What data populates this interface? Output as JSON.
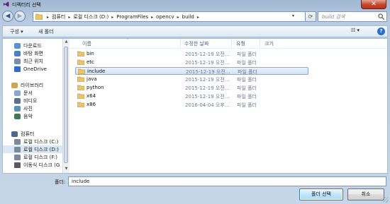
{
  "window": {
    "title": "디렉터리 선택",
    "close_label": "✕"
  },
  "address": {
    "crumbs": [
      "컴퓨터",
      "로컬 디스크 (D:)",
      "ProgramFiles",
      "opencv",
      "build"
    ],
    "separator": "▸",
    "search_placeholder": "build 검색"
  },
  "toolbar": {
    "organize_label": "구성 ▾",
    "new_folder_label": "새 폴더",
    "view_label": "☷ ▾",
    "help_label": "?"
  },
  "sidebar": {
    "items": [
      {
        "label": "다운로드",
        "icon": "download-folder-icon"
      },
      {
        "label": "바탕 화면",
        "icon": "desktop-icon"
      },
      {
        "label": "최근 위치",
        "icon": "recent-places-icon"
      },
      {
        "label": "OneDrive",
        "icon": "onedrive-icon"
      },
      {
        "label": "라이브러리",
        "icon": "library-icon"
      },
      {
        "label": "문서",
        "icon": "documents-icon"
      },
      {
        "label": "비디오",
        "icon": "videos-icon"
      },
      {
        "label": "사진",
        "icon": "pictures-icon"
      },
      {
        "label": "음악",
        "icon": "music-icon"
      },
      {
        "label": "컴퓨터",
        "icon": "computer-icon"
      },
      {
        "label": "로컬 디스크 (C:)",
        "icon": "drive-icon"
      },
      {
        "label": "로컬 디스크 (D:)",
        "icon": "drive-icon"
      },
      {
        "label": "로컬 디스크 (F:)",
        "icon": "drive-icon"
      },
      {
        "label": "이동식 디스크 (G",
        "icon": "removable-drive-icon"
      }
    ]
  },
  "columns": {
    "name": "이름",
    "date": "수정한 날짜",
    "type": "유형",
    "size": "크기"
  },
  "files": [
    {
      "name": "bin",
      "date": "2015-12-19 오전...",
      "type": "파일 폴더"
    },
    {
      "name": "etc",
      "date": "2015-12-19 오전...",
      "type": "파일 폴더"
    },
    {
      "name": "include",
      "date": "2015-12-19 오전...",
      "type": "파일 폴더"
    },
    {
      "name": "java",
      "date": "2015-12-19 오전...",
      "type": "파일 폴더"
    },
    {
      "name": "python",
      "date": "2015-12-19 오전...",
      "type": "파일 폴더"
    },
    {
      "name": "x64",
      "date": "2015-12-19 오전...",
      "type": "파일 폴더"
    },
    {
      "name": "x86",
      "date": "2016-04-04 오후...",
      "type": "파일 폴더"
    }
  ],
  "selected_file": "include",
  "footer": {
    "folder_label": "폴더:",
    "folder_value": "include",
    "select_label": "폴더 선택",
    "cancel_label": "취소"
  },
  "colors": {
    "selection": "#cfe2fa",
    "titlebar": "#9fb7d2",
    "close": "#c4472e"
  }
}
